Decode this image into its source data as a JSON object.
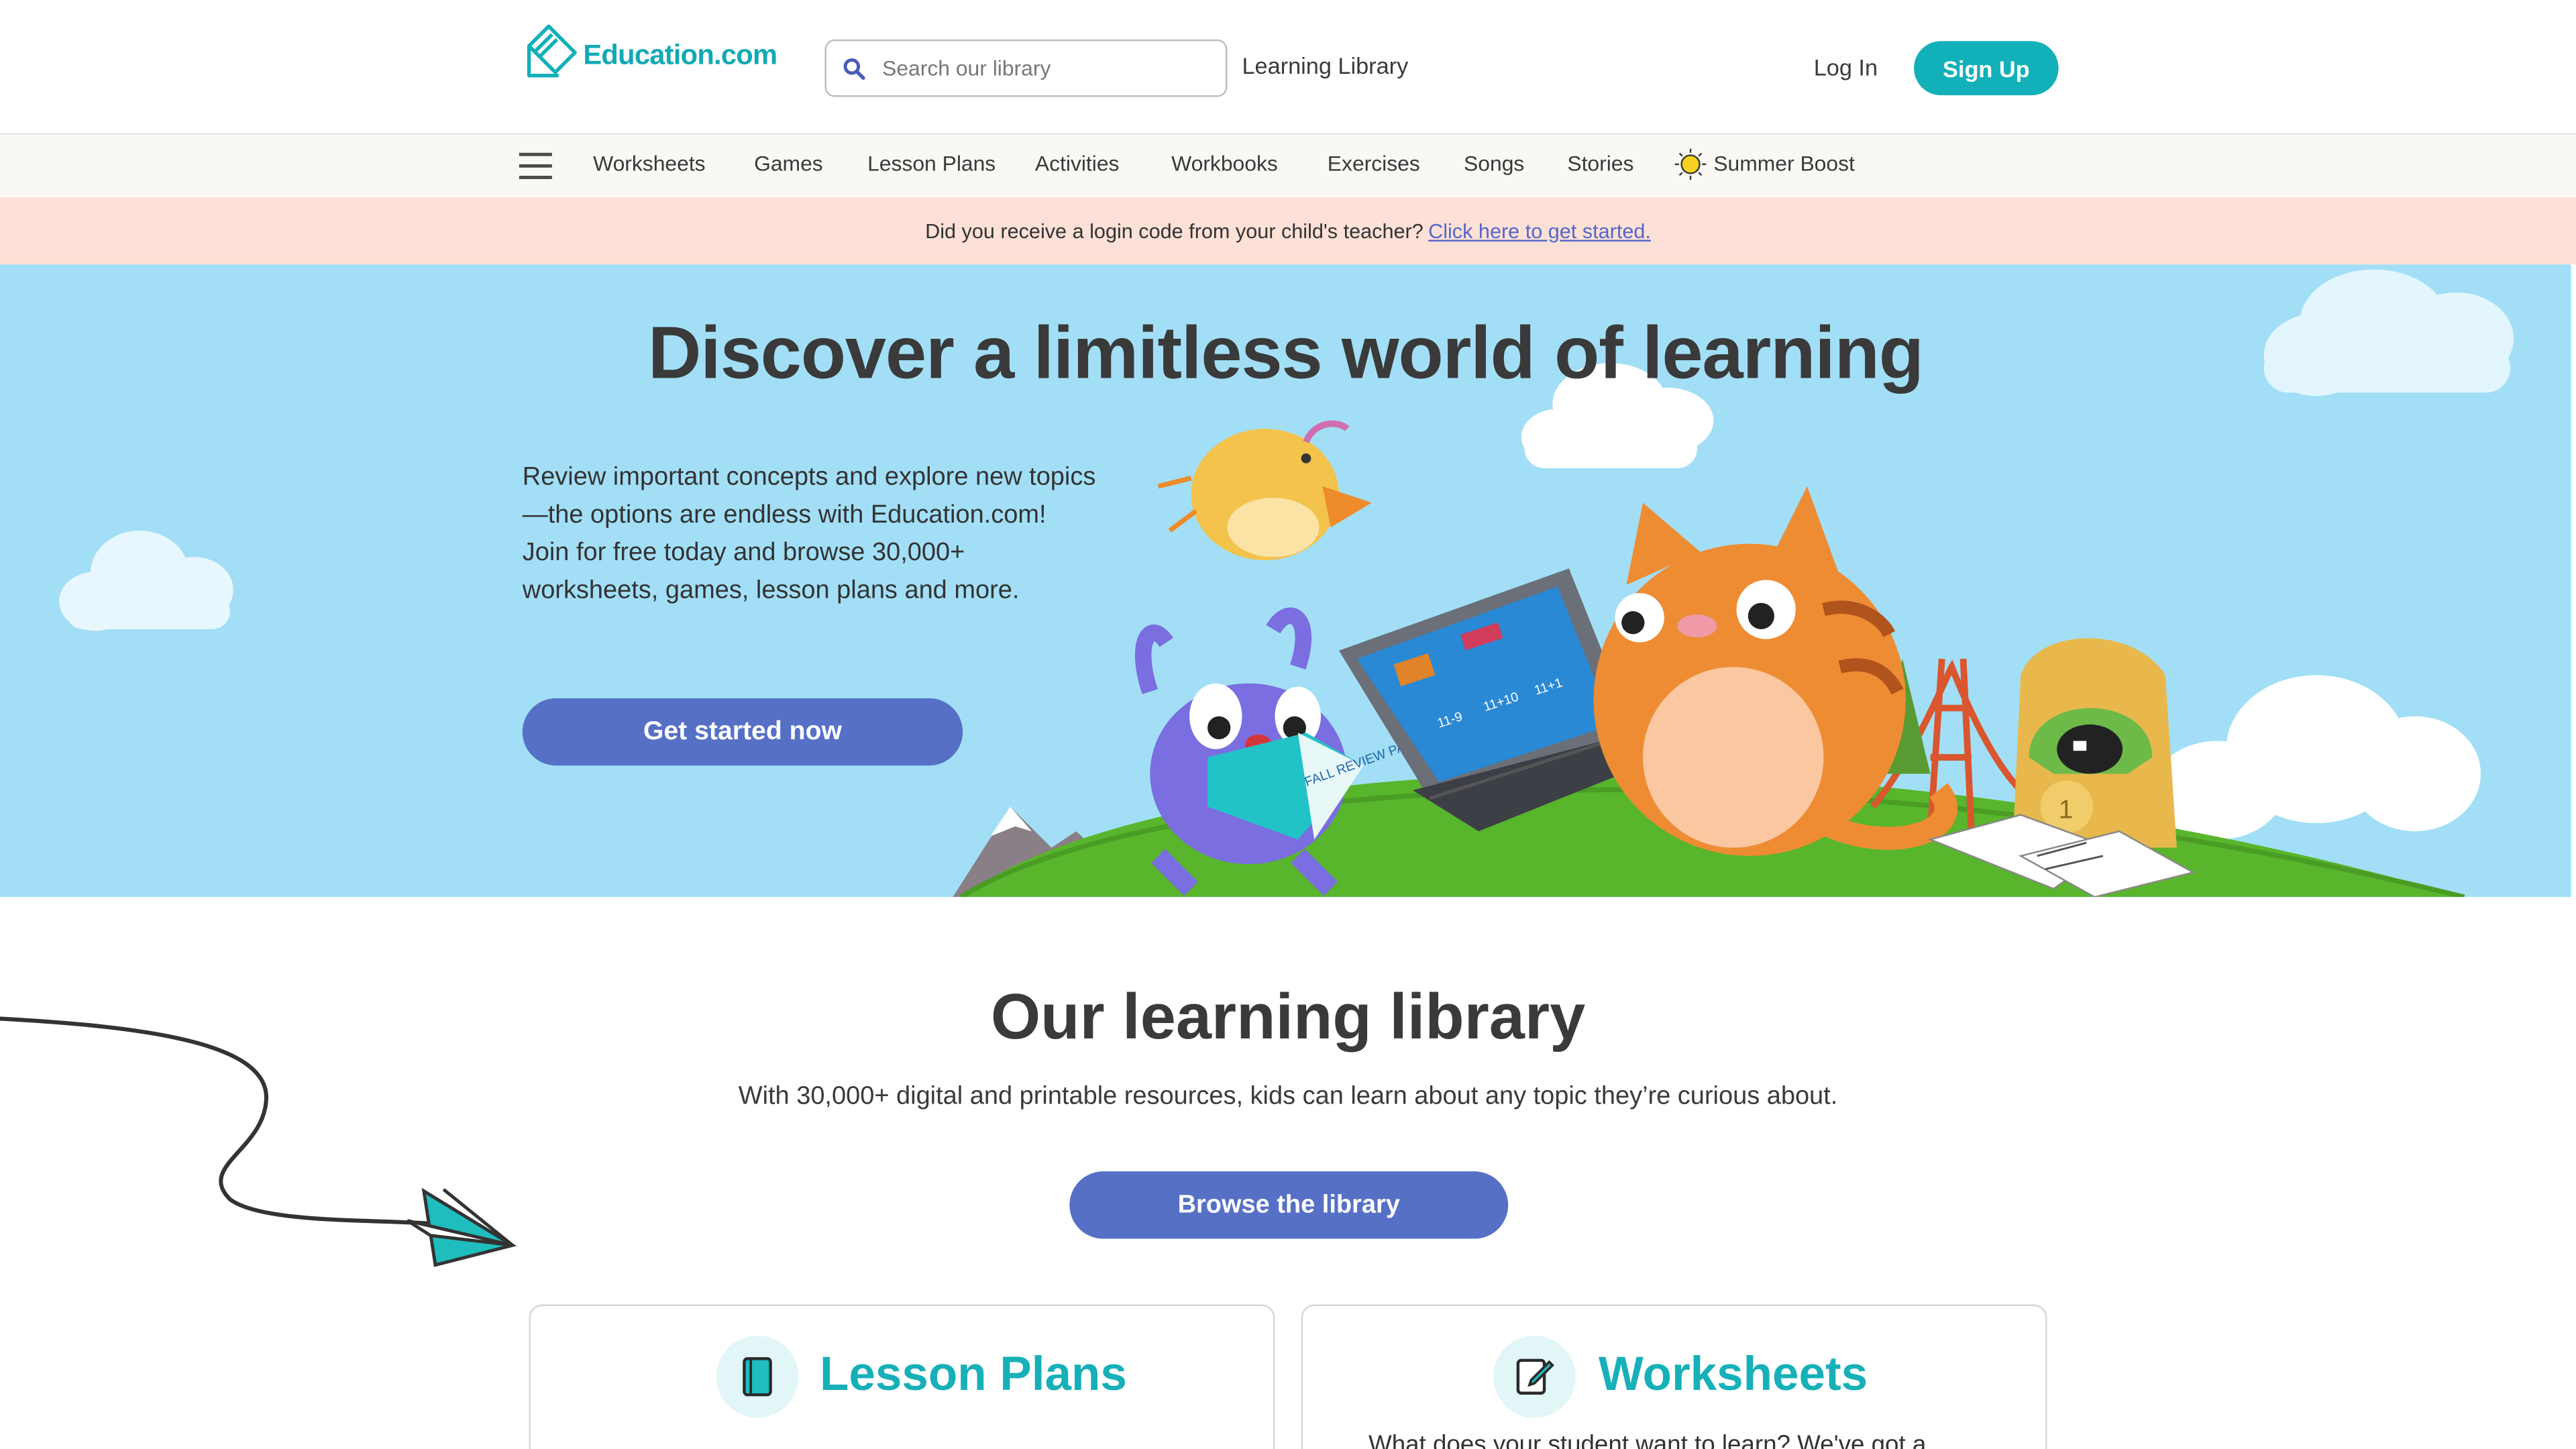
{
  "header": {
    "logo_text": "Education.com",
    "search_placeholder": "Search our library",
    "library_link": "Learning Library",
    "login_label": "Log In",
    "signup_label": "Sign Up"
  },
  "nav": {
    "items": [
      "Worksheets",
      "Games",
      "Lesson Plans",
      "Activities",
      "Workbooks",
      "Exercises",
      "Songs",
      "Stories",
      "Summer Boost"
    ]
  },
  "banner": {
    "text": "Did you receive a login code from your child's teacher?",
    "link": "Click here to get started."
  },
  "hero": {
    "title": "Discover a limitless world of learning",
    "text": "Review important concepts and explore new topics—the options are endless with Education.com! Join for free today and browse 30,000+ worksheets, games, lesson plans and more.",
    "cta": "Get started now",
    "laptop_labels": [
      "11-9",
      "11+10",
      "11+1"
    ],
    "book_label": "FALL REVIEW PACKET",
    "trophy_label": "1"
  },
  "library": {
    "title": "Our learning library",
    "subtitle": "With 30,000+ digital and printable resources, kids can learn about any topic they’re curious about.",
    "browse_label": "Browse the library"
  },
  "cards": [
    {
      "title": "Lesson Plans",
      "icon": "book-icon",
      "description": ""
    },
    {
      "title": "Worksheets",
      "icon": "worksheet-icon",
      "description": "What does your student want to learn? We've got a"
    }
  ],
  "colors": {
    "brand_teal": "#12b0b8",
    "button_blue": "#5670c6",
    "hero_sky": "#a2dff7",
    "banner_pink": "#fde0d6"
  }
}
